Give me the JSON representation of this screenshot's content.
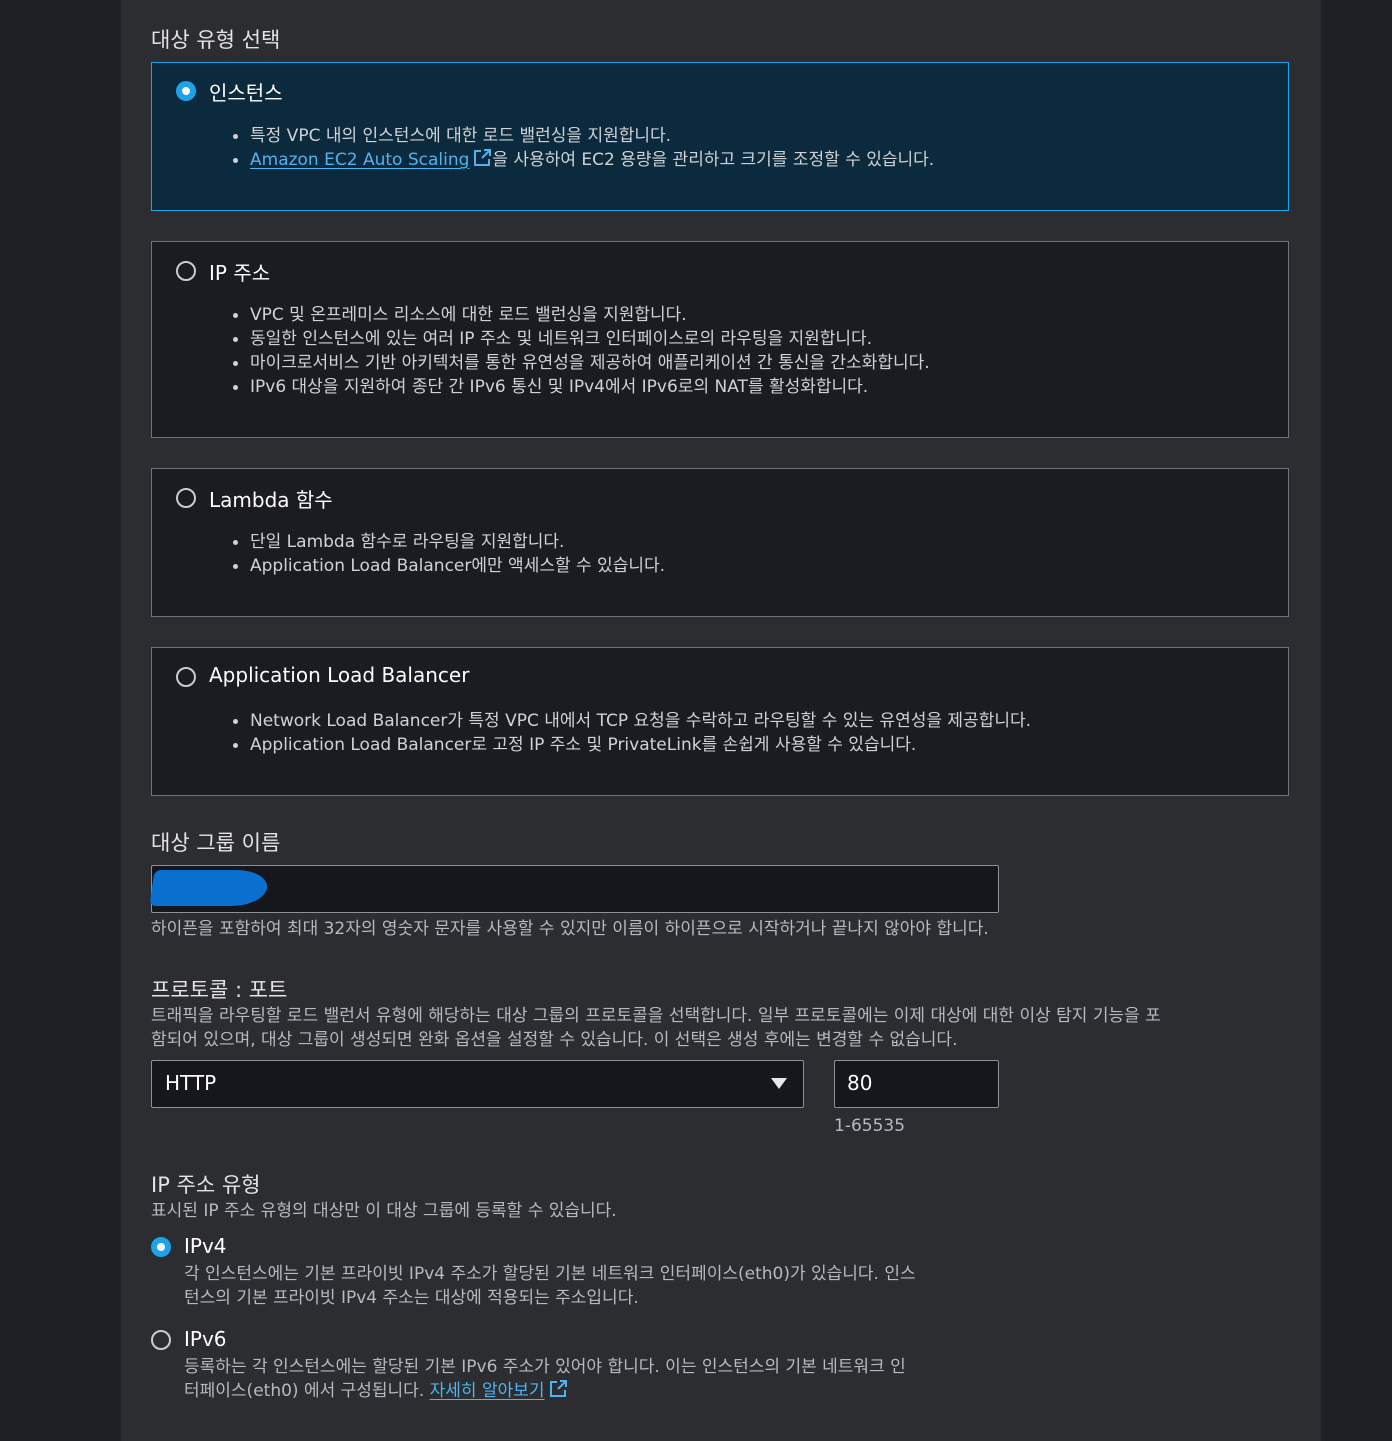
{
  "target_type": {
    "heading": "대상 유형 선택",
    "options": [
      {
        "label": "인스턴스",
        "selected": true,
        "bullets": [
          "특정 VPC 내의 인스턴스에 대한 로드 밸런싱을 지원합니다.",
          "을 사용하여 EC2 용량을 관리하고 크기를 조정할 수 있습니다."
        ],
        "link_text": "Amazon EC2 Auto Scaling"
      },
      {
        "label": "IP 주소",
        "selected": false,
        "bullets": [
          "VPC 및 온프레미스 리소스에 대한 로드 밸런싱을 지원합니다.",
          "동일한 인스턴스에 있는 여러 IP 주소 및 네트워크 인터페이스로의 라우팅을 지원합니다.",
          "마이크로서비스 기반 아키텍처를 통한 유연성을 제공하여 애플리케이션 간 통신을 간소화합니다.",
          "IPv6 대상을 지원하여 종단 간 IPv6 통신 및 IPv4에서 IPv6로의 NAT를 활성화합니다."
        ]
      },
      {
        "label": "Lambda 함수",
        "selected": false,
        "bullets": [
          "단일 Lambda 함수로 라우팅을 지원합니다.",
          "Application Load Balancer에만 액세스할 수 있습니다."
        ]
      },
      {
        "label": "Application Load Balancer",
        "selected": false,
        "bullets": [
          "Network Load Balancer가 특정 VPC 내에서 TCP 요청을 수락하고 라우팅할 수 있는 유연성을 제공합니다.",
          "Application Load Balancer로 고정 IP 주소 및 PrivateLink를 손쉽게 사용할 수 있습니다."
        ]
      }
    ]
  },
  "group_name": {
    "heading": "대상 그룹 이름",
    "value": "",
    "help": "하이픈을 포함하여 최대 32자의 영숫자 문자를 사용할 수 있지만 이름이 하이픈으로 시작하거나 끝나지 않아야 합니다."
  },
  "protocol_port": {
    "heading": "프로토콜 : 포트",
    "description_line1": "트래픽을 라우팅할 로드 밸런서 유형에 해당하는 대상 그룹의 프로토콜을 선택합니다. 일부 프로토콜에는 이제 대상에 대한 이상 탐지 기능을 포",
    "description_line2": "함되어 있으며, 대상 그룹이 생성되면 완화 옵션을 설정할 수 있습니다. 이 선택은 생성 후에는 변경할 수 없습니다.",
    "protocol": "HTTP",
    "port": "80",
    "port_range": "1-65535"
  },
  "ip_address_type": {
    "heading": "IP 주소 유형",
    "description": "표시된 IP 주소 유형의 대상만 이 대상 그룹에 등록할 수 있습니다.",
    "options": [
      {
        "label": "IPv4",
        "selected": true,
        "desc_line1": "각 인스턴스에는 기본 프라이빗 IPv4 주소가 할당된 기본 네트워크 인터페이스(eth0)가 있습니다. 인스",
        "desc_line2": "턴스의 기본 프라이빗 IPv4 주소는 대상에 적용되는 주소입니다."
      },
      {
        "label": "IPv6",
        "selected": false,
        "desc_line1": "등록하는 각 인스턴스에는 할당된 기본 IPv6 주소가 있어야 합니다. 이는 인스턴스의 기본 네트워크 인",
        "desc_line2": "터페이스(eth0) 에서 구성됩니다.",
        "link_text": "자세히 알아보기"
      }
    ]
  },
  "colors": {
    "accent": "#1ca3ea",
    "link": "#4fb3f0",
    "panel": "#2b2d31",
    "background": "#1e2025"
  }
}
